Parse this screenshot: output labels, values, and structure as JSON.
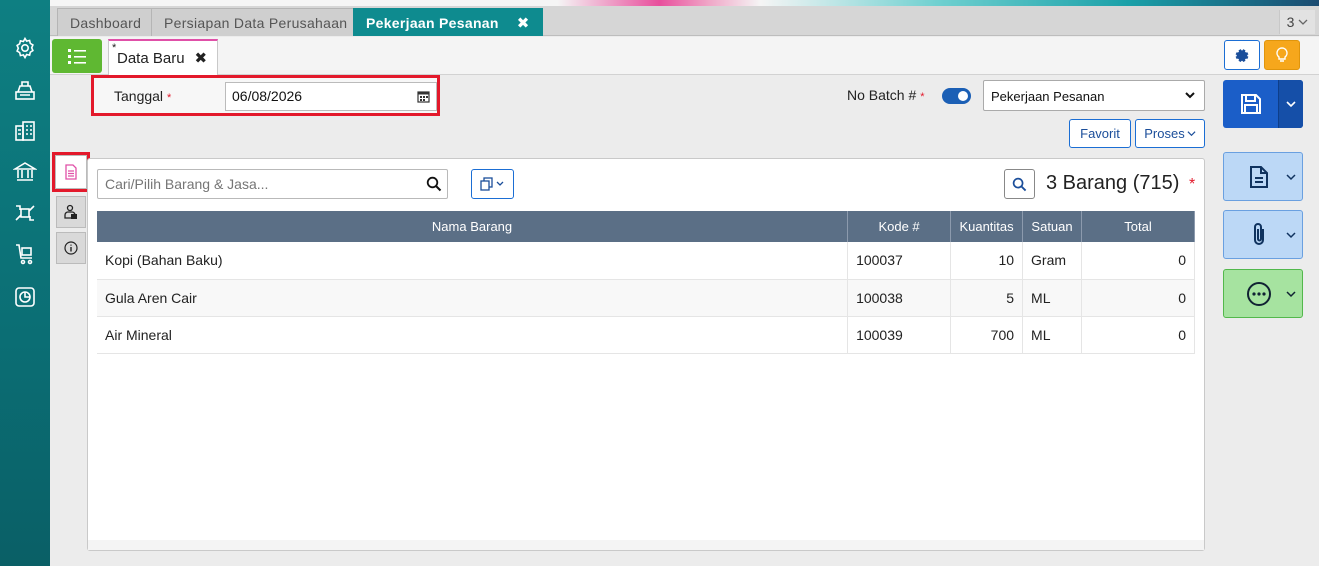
{
  "tabs": [
    {
      "label": "Dashboard"
    },
    {
      "label": "Persiapan Data Perusahaan"
    },
    {
      "label": "Pekerjaan Pesanan",
      "close": "✖"
    }
  ],
  "tab_count": "3",
  "doc_tab": {
    "modified_mark": "*",
    "label": "Data Baru",
    "close": "✖"
  },
  "form": {
    "tanggal_label": "Tanggal",
    "required_mark": "*",
    "tanggal_value": "06/08/2026",
    "batch_label": "No Batch #",
    "batch_select_value": "Pekerjaan Pesanan"
  },
  "actions": {
    "favorit": "Favorit",
    "proses": "Proses"
  },
  "items": {
    "search_placeholder": "Cari/Pilih Barang & Jasa...",
    "count_text": "3 Barang (715)",
    "columns": [
      "Nama Barang",
      "Kode #",
      "Kuantitas",
      "Satuan",
      "Total"
    ],
    "rows": [
      {
        "nama": "Kopi (Bahan Baku)",
        "kode": "100037",
        "qty": "10",
        "satuan": "Gram",
        "total": "0"
      },
      {
        "nama": "Gula Aren Cair",
        "kode": "100038",
        "qty": "5",
        "satuan": "ML",
        "total": "0"
      },
      {
        "nama": "Air Mineral",
        "kode": "100039",
        "qty": "700",
        "satuan": "ML",
        "total": "0"
      }
    ]
  },
  "colors": {
    "sidebar": "#0e7f82",
    "active_tab": "#0e8b8f",
    "primary": "#1b5ec8",
    "required": "#e3192b"
  }
}
